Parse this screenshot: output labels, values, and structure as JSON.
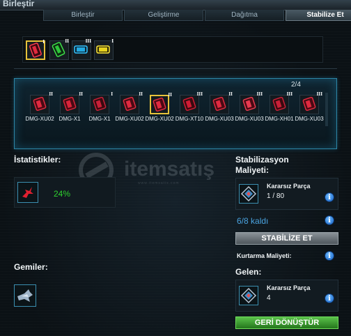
{
  "window": {
    "title": "Birleştir"
  },
  "tabs": [
    {
      "label": "Birleştir",
      "active": false
    },
    {
      "label": "Geliştirme",
      "active": false
    },
    {
      "label": "Dağıtma",
      "active": false
    },
    {
      "label": "Stabilize Et",
      "active": true
    }
  ],
  "top_slots": [
    {
      "icon": "red-laser-item-icon",
      "tier": "I",
      "color": "#c8243a",
      "selected": true
    },
    {
      "icon": "green-module-icon",
      "tier": "II",
      "color": "#2ec43a",
      "selected": false
    },
    {
      "icon": "blue-module-icon",
      "tier": "III",
      "color": "#22a8e0",
      "selected": false
    },
    {
      "icon": "yellow-module-icon",
      "tier": "I",
      "color": "#e6d21e",
      "selected": false
    }
  ],
  "inventory": {
    "page": "2/4",
    "items": [
      {
        "label": "DMG-XU02",
        "tier": "II",
        "selected": false
      },
      {
        "label": "DMG-X1",
        "tier": "II",
        "selected": false
      },
      {
        "label": "DMG-X1",
        "tier": "I",
        "selected": false
      },
      {
        "label": "DMG-XU02",
        "tier": "II",
        "selected": false
      },
      {
        "label": "DMG-XU02",
        "tier": "II",
        "selected": true
      },
      {
        "label": "DMG-XT10",
        "tier": "III",
        "selected": false
      },
      {
        "label": "DMG-XU03",
        "tier": "II",
        "selected": false
      },
      {
        "label": "DMG-XU03",
        "tier": "III",
        "selected": false
      },
      {
        "label": "DMG-XH01",
        "tier": "III",
        "selected": false
      },
      {
        "label": "DMG-XU03",
        "tier": "III",
        "selected": false
      }
    ]
  },
  "stats": {
    "heading": "İstatistikler:",
    "value": "24%",
    "icon": "damage-stat-icon"
  },
  "ships": {
    "heading": "Gemiler:",
    "icon": "ship-icon"
  },
  "cost": {
    "heading_line1": "Stabilizasyon",
    "heading_line2": "Maliyeti:",
    "resource_name": "Kararsız Parça",
    "resource_value": "1 / 80",
    "remaining": "6/8 kaldı",
    "stabilize_button": "STABİLİZE ET",
    "salvage_label": "Kurtarma Maliyeti:"
  },
  "gain": {
    "heading": "Gelen:",
    "resource_name": "Kararsız Parça",
    "resource_value": "4",
    "recycle_button": "GERİ DÖNÜŞTÜR"
  },
  "watermark": {
    "text": "itemsatış",
    "sub": "www.itemsatis.com"
  },
  "colors": {
    "accent": "#2d86a6",
    "positive": "#2fd12f",
    "select": "#e6c23a",
    "info": "#1560c4"
  }
}
